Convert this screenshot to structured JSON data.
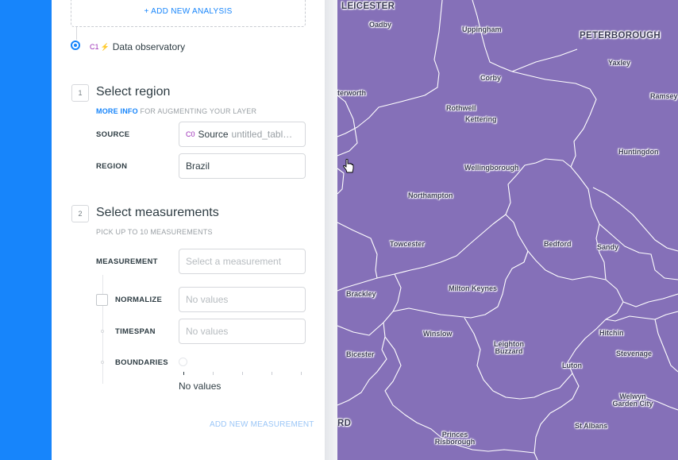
{
  "sidebar": {
    "add_analysis_label": "+ ADD NEW ANALYSIS",
    "analysis": {
      "badge": "C1",
      "title": "Data observatory"
    },
    "step1": {
      "number": "1",
      "title": "Select region",
      "more_info": "MORE INFO",
      "subtitle": "FOR AUGMENTING YOUR LAYER",
      "source_label": "SOURCE",
      "source_badge": "C0",
      "source_value": "Source",
      "source_table": "untitled_tabl…",
      "region_label": "REGION",
      "region_value": "Brazil"
    },
    "step2": {
      "number": "2",
      "title": "Select measurements",
      "subtitle": "PICK UP TO 10 MEASUREMENTS",
      "measurement_label": "MEASUREMENT",
      "measurement_placeholder": "Select a measurement",
      "normalize_label": "NORMALIZE",
      "normalize_placeholder": "No values",
      "timespan_label": "TIMESPAN",
      "timespan_placeholder": "No values",
      "boundaries_label": "BOUNDARIES",
      "boundaries_value": "No values",
      "add_measurement_label": "ADD NEW MEASUREMENT"
    }
  },
  "map": {
    "fill_color": "#8570b8",
    "places": [
      "LEICESTER",
      "Oadby",
      "Uppingham",
      "PETERBOROUGH",
      "Yaxley",
      "Corby",
      "terworth",
      "Ramsey",
      "Rothwell",
      "Kettering",
      "Huntingdon",
      "Wellingborough",
      "Northampton",
      "Towcester",
      "Bedford",
      "Sandy",
      "Brackley",
      "Milton Keynes",
      "Winslow",
      "Leighton Buzzard",
      "Hitchin",
      "Bicester",
      "Stevenage",
      "Luton",
      "Welwyn Garden City",
      "RD",
      "St Albans",
      "Princes Risborough"
    ]
  }
}
